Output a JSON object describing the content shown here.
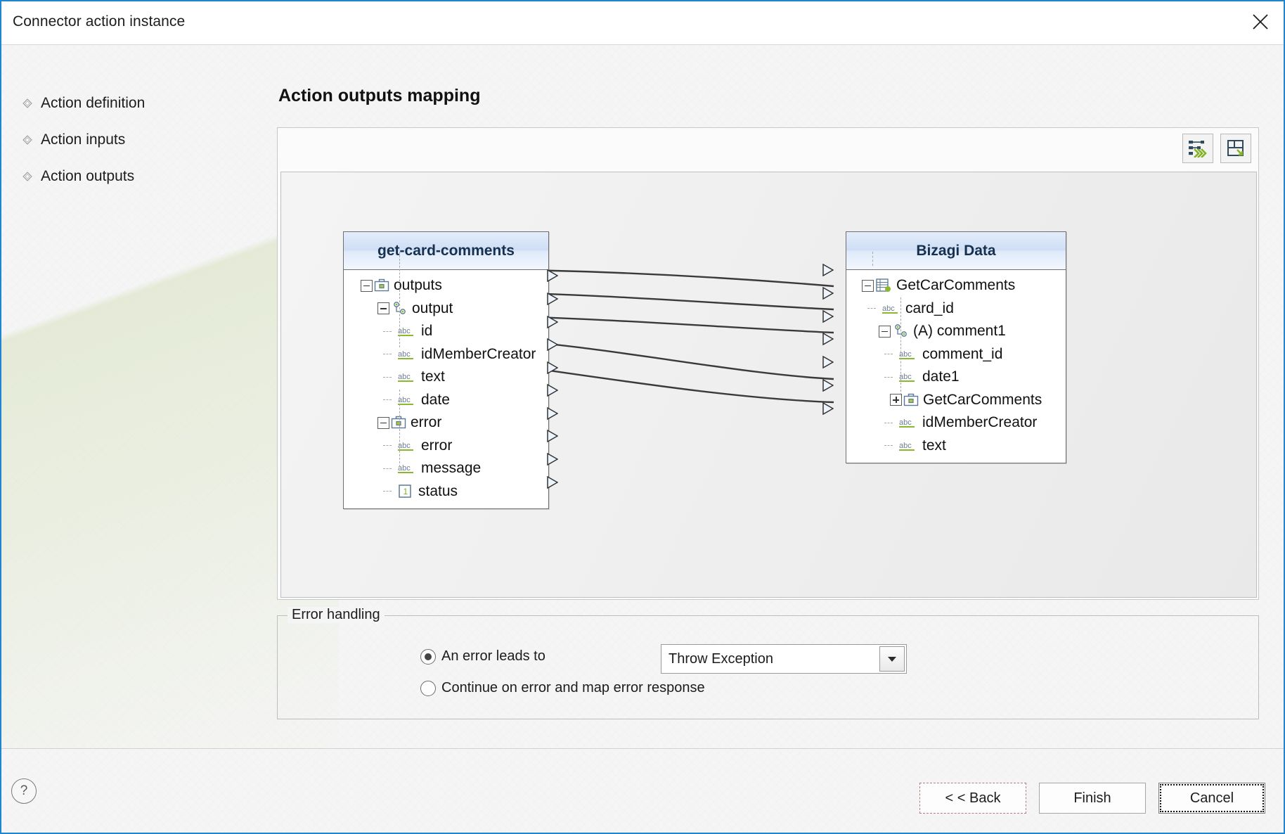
{
  "window": {
    "title": "Connector action instance",
    "close_icon": "close-icon"
  },
  "steps": [
    {
      "label": "Action definition",
      "icon": "diamond-bullet-icon"
    },
    {
      "label": "Action inputs",
      "icon": "diamond-bullet-icon"
    },
    {
      "label": "Action outputs",
      "icon": "diamond-bullet-icon"
    }
  ],
  "main": {
    "title": "Action outputs mapping",
    "toolbar": [
      {
        "name": "auto-map-icon",
        "tooltip": "Auto map"
      },
      {
        "name": "save-mapping-icon",
        "tooltip": "Save mapping"
      }
    ]
  },
  "mapping": {
    "source": {
      "title": "get-card-comments",
      "rows": [
        {
          "label": "outputs",
          "indent": 0,
          "icon": "briefcase-icon",
          "expander": "minus",
          "port": true
        },
        {
          "label": "output",
          "indent": 1,
          "icon": "node-link-icon",
          "expander": "minus",
          "port": true
        },
        {
          "label": "id",
          "indent": 2,
          "icon": "abc-icon",
          "expander": "none",
          "port": true
        },
        {
          "label": "idMemberCreator",
          "indent": 2,
          "icon": "abc-icon",
          "expander": "none",
          "port": true
        },
        {
          "label": "text",
          "indent": 2,
          "icon": "abc-icon",
          "expander": "none",
          "port": true
        },
        {
          "label": "date",
          "indent": 2,
          "icon": "abc-icon",
          "expander": "none",
          "port": true
        },
        {
          "label": "error",
          "indent": 1,
          "icon": "briefcase-icon",
          "expander": "minus",
          "port": true
        },
        {
          "label": "error",
          "indent": 2,
          "icon": "abc-icon",
          "expander": "none",
          "port": true
        },
        {
          "label": "message",
          "indent": 2,
          "icon": "abc-icon",
          "expander": "none",
          "port": true
        },
        {
          "label": "status",
          "indent": 2,
          "icon": "number-one-icon",
          "expander": "none",
          "port": true
        }
      ]
    },
    "target": {
      "title": "Bizagi Data",
      "rows": [
        {
          "label": "GetCarComments",
          "indent": 0,
          "icon": "table-entity-icon",
          "expander": "minus",
          "port": true
        },
        {
          "label": "card_id",
          "indent": 1,
          "icon": "abc-icon",
          "expander": "none",
          "port": true
        },
        {
          "label": "(A) comment1",
          "indent": 1,
          "icon": "node-link-icon",
          "expander": "minus",
          "port": true
        },
        {
          "label": "comment_id",
          "indent": 2,
          "icon": "abc-icon",
          "expander": "none",
          "port": true
        },
        {
          "label": "date1",
          "indent": 2,
          "icon": "abc-icon",
          "expander": "none",
          "port": true
        },
        {
          "label": "GetCarComments",
          "indent": 2,
          "icon": "briefcase-icon",
          "expander": "plus",
          "port": true
        },
        {
          "label": "idMemberCreator",
          "indent": 2,
          "icon": "abc-icon",
          "expander": "none",
          "port": true
        },
        {
          "label": "text",
          "indent": 2,
          "icon": "abc-icon",
          "expander": "none",
          "port": true
        }
      ]
    },
    "links": [
      {
        "from": "output",
        "to": "(A) comment1"
      },
      {
        "from": "id",
        "to": "comment_id"
      },
      {
        "from": "idMemberCreator",
        "to": "date1"
      },
      {
        "from": "text",
        "to": "idMemberCreator"
      },
      {
        "from": "date",
        "to": "text"
      }
    ]
  },
  "error_handling": {
    "legend": "Error handling",
    "options": [
      {
        "label": "An error leads to",
        "selected": true
      },
      {
        "label": "Continue on error and map error response",
        "selected": false
      }
    ],
    "select": {
      "value": "Throw Exception",
      "arrow_icon": "chevron-down-icon"
    }
  },
  "footer": {
    "help_icon": "?",
    "buttons": [
      {
        "label": "< < Back",
        "name": "back-button"
      },
      {
        "label": "Finish",
        "name": "finish-button"
      },
      {
        "label": "Cancel",
        "name": "cancel-button"
      }
    ]
  },
  "colors": {
    "accent": "#1e86d0",
    "header_gradient": "#cfdef5",
    "icon_green": "#8cb82b",
    "icon_slate": "#5c7a94"
  }
}
